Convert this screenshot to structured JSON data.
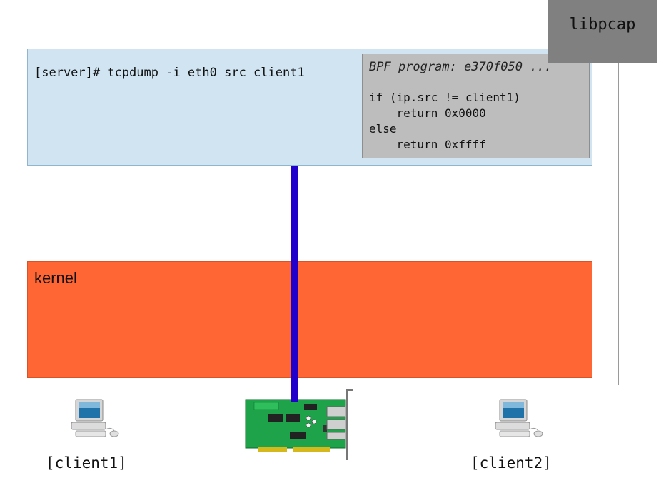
{
  "libpcap": {
    "label": "libpcap"
  },
  "userspace": {
    "command": "[server]# tcpdump -i eth0 src client1"
  },
  "bpf": {
    "title": "BPF program: e370f050 ...",
    "lines": [
      "if (ip.src != client1)",
      "    return 0x0000",
      "else",
      "    return 0xffff"
    ]
  },
  "kernel": {
    "label": "kernel"
  },
  "clients": [
    {
      "label": "[client1]"
    },
    {
      "label": "[client2]"
    }
  ],
  "colors": {
    "userspace_bg": "#d0e4f2",
    "bpf_bg": "#bdbdbd",
    "kernel_bg": "#ff6633",
    "libpcap_bg": "#808080",
    "link": "#2200cc",
    "nic_board": "#1fa34a"
  }
}
